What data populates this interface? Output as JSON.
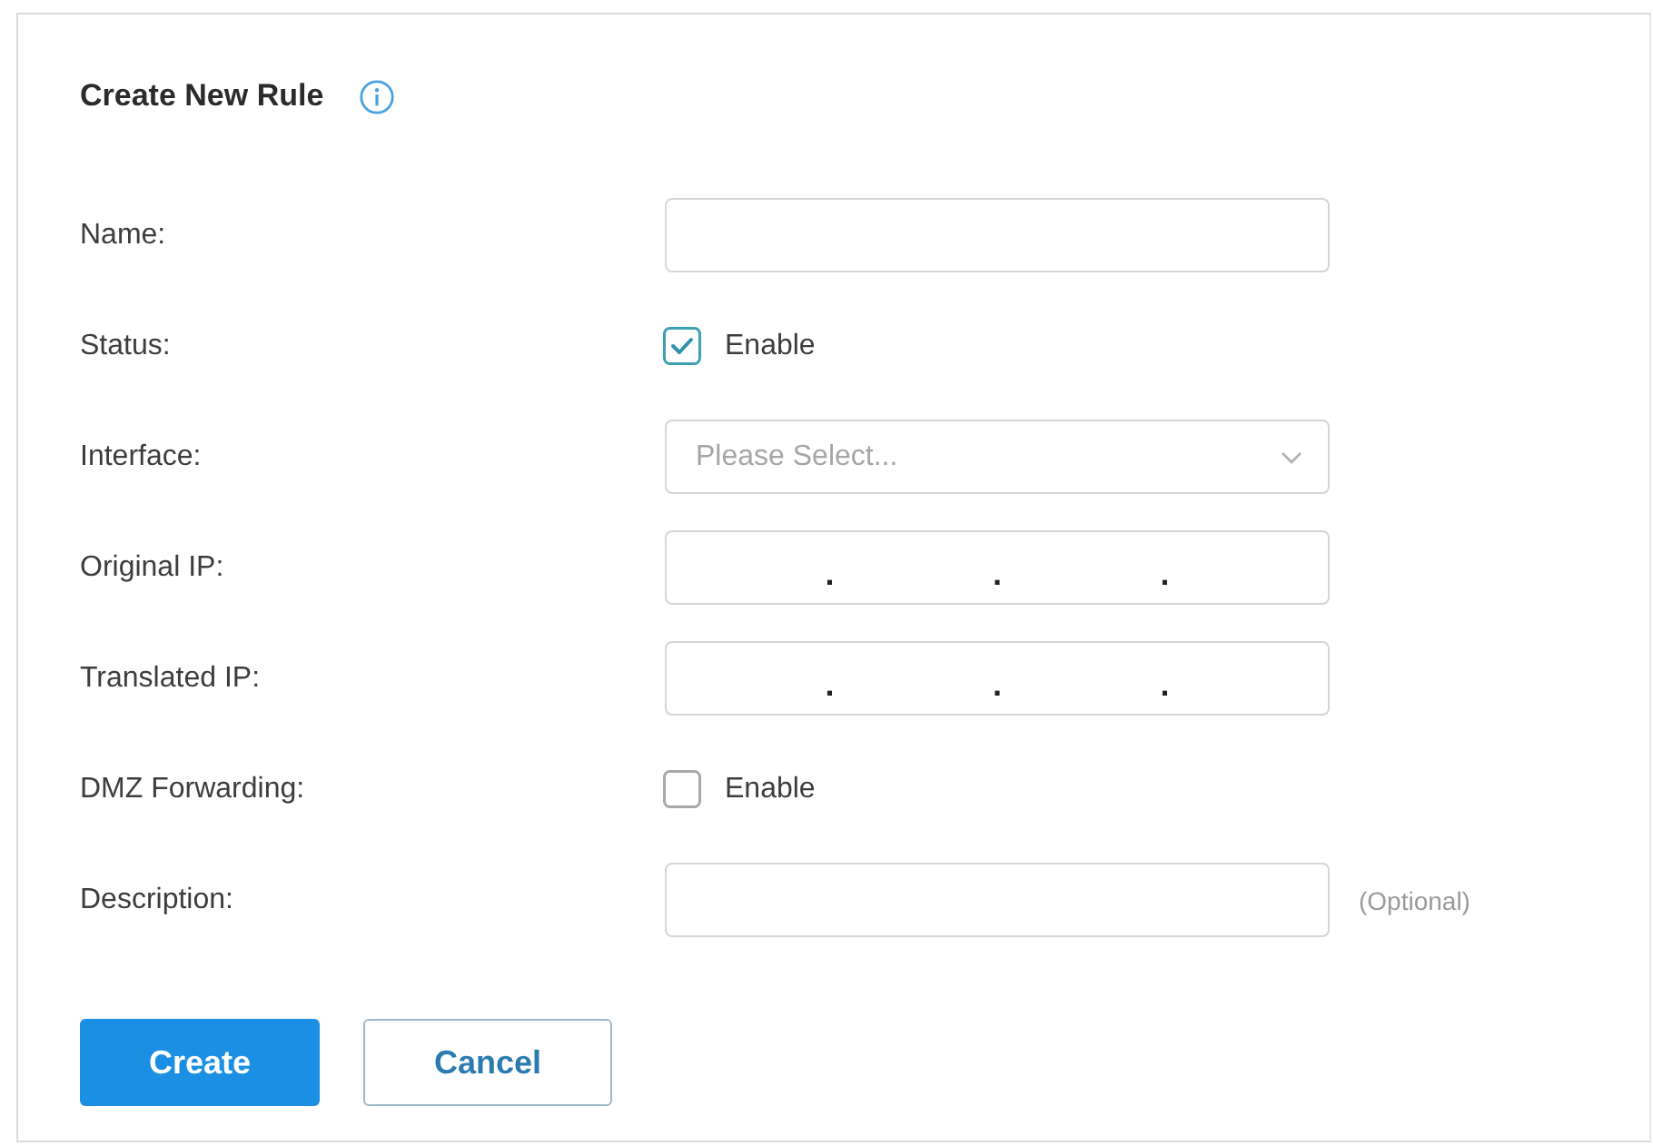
{
  "form": {
    "title": "Create New Rule",
    "fields": [
      {
        "kind": "text",
        "label": "Name:"
      },
      {
        "kind": "checkbox",
        "label": "Status:",
        "option": "Enable",
        "checked": true
      },
      {
        "kind": "select",
        "label": "Interface:",
        "placeholder": "Please Select..."
      },
      {
        "kind": "ip",
        "label": "Original IP:",
        "separators": [
          ".",
          ".",
          "."
        ]
      },
      {
        "kind": "ip",
        "label": "Translated IP:",
        "separators": [
          ".",
          ".",
          "."
        ]
      },
      {
        "kind": "checkbox",
        "label": "DMZ Forwarding:",
        "option": "Enable",
        "checked": false
      },
      {
        "kind": "text",
        "label": "Description:",
        "hint": "(Optional)"
      }
    ],
    "buttons": [
      {
        "kind": "primary",
        "label": "Create"
      },
      {
        "kind": "secondary",
        "label": "Cancel"
      }
    ]
  }
}
